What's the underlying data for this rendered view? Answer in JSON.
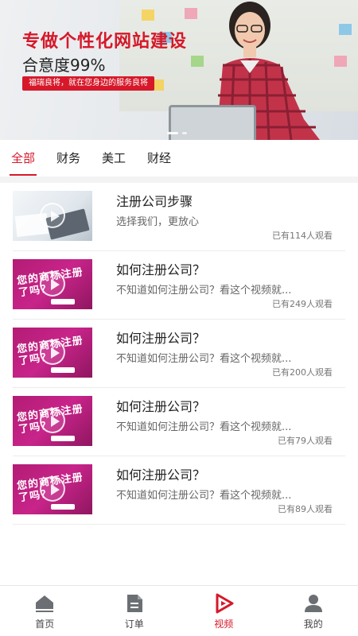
{
  "banner": {
    "title": "专做个性化网站建设",
    "subtitle": "合意度99%",
    "tagline": "福瑞良将，就在您身边的服务良将"
  },
  "tabs": [
    {
      "label": "全部",
      "active": true
    },
    {
      "label": "财务",
      "active": false
    },
    {
      "label": "美工",
      "active": false
    },
    {
      "label": "财经",
      "active": false
    }
  ],
  "videos": [
    {
      "title": "注册公司步骤",
      "desc": "选择我们，更放心",
      "views": "已有114人观看",
      "thumb": "office-calculator"
    },
    {
      "title": "如何注册公司？",
      "desc": "不知道如何注册公司？看这个视频就...",
      "views": "已有249人观看",
      "thumb": "promo"
    },
    {
      "title": "如何注册公司？",
      "desc": "不知道如何注册公司？看这个视频就...",
      "views": "已有200人观看",
      "thumb": "promo"
    },
    {
      "title": "如何注册公司？",
      "desc": "不知道如何注册公司？看这个视频就...",
      "views": "已有79人观看",
      "thumb": "promo"
    },
    {
      "title": "如何注册公司？",
      "desc": "不知道如何注册公司？看这个视频就...",
      "views": "已有89人观看",
      "thumb": "promo"
    }
  ],
  "promo_text": "您的商标注册了吗？",
  "bottom_nav": [
    {
      "label": "首页",
      "icon": "home-icon",
      "active": false
    },
    {
      "label": "订单",
      "icon": "order-icon",
      "active": false
    },
    {
      "label": "视频",
      "icon": "video-play-icon",
      "active": true
    },
    {
      "label": "我的",
      "icon": "user-icon",
      "active": false
    }
  ],
  "colors": {
    "accent": "#d6182a",
    "inactive_icon": "#6b6f74",
    "promo_bg": "#b31c74"
  }
}
